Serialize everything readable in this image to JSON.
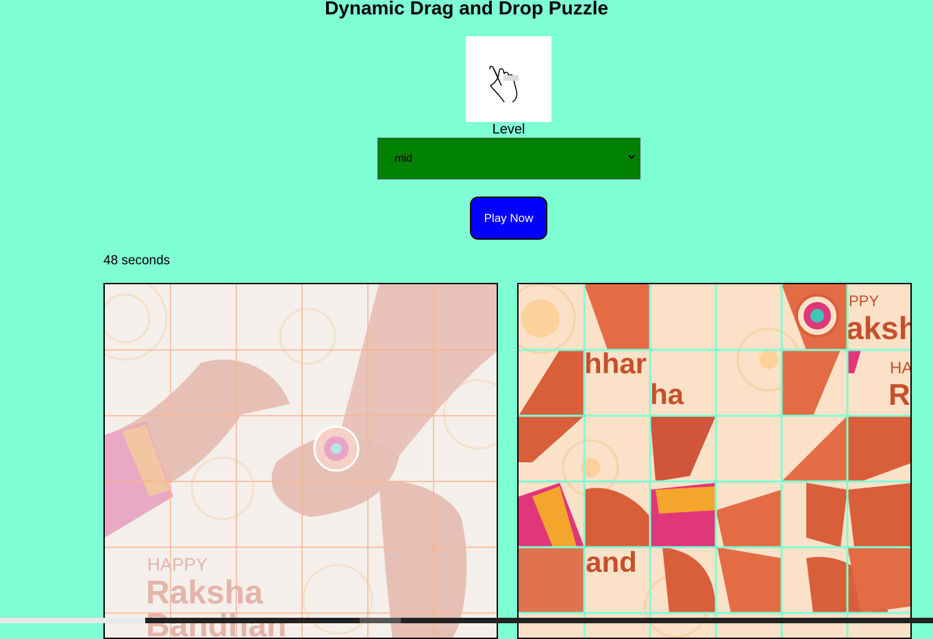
{
  "page": {
    "title": "Dynamic Drag and Drop Puzzle",
    "hand_icon": "pointing-hand-icon"
  },
  "level": {
    "label": "Level",
    "selected": "mid"
  },
  "play_button": {
    "label": "Play Now"
  },
  "timer": {
    "text": "48 seconds"
  },
  "reference_board": {
    "happy_text": "HAPPY",
    "raksha_text": "Raksha",
    "bandhan_text": "Bandhan"
  },
  "puzzle_board": {
    "grid": "6x5 visible",
    "tile_texts": [
      "hhar",
      "ha",
      "PPY",
      "aksh",
      "HA",
      "R",
      "and"
    ]
  },
  "colors": {
    "background": "#7fffd4",
    "select_bg": "#008000",
    "button_bg": "#0000ff",
    "tile_gap": "#7fffd4"
  }
}
